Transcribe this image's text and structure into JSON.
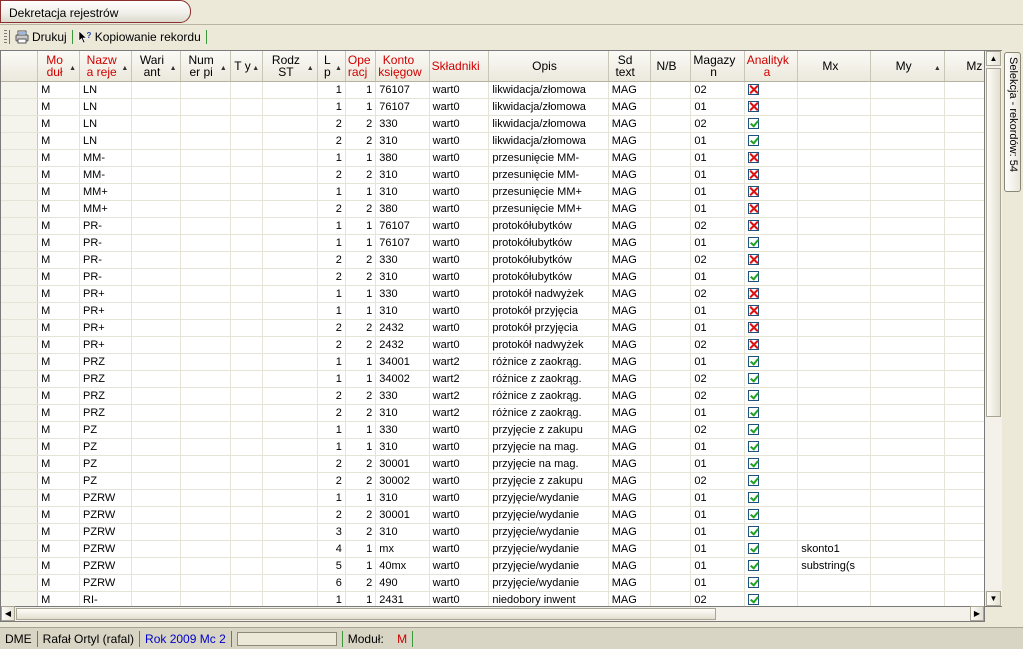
{
  "window": {
    "title": "Dekretacja rejestrów"
  },
  "toolbar": {
    "print_label": "Drukuj",
    "copy_label": "Kopiowanie rekordu"
  },
  "side_tab": {
    "label": "Selekcja - rekordów: 54"
  },
  "grid": {
    "columns": [
      {
        "key": "modul",
        "label": "Mo duł",
        "red": true,
        "sort": true
      },
      {
        "key": "nazwa",
        "label": "Nazw a reje",
        "red": true,
        "sort": true
      },
      {
        "key": "wariant",
        "label": "Wari ant",
        "red": false,
        "sort": true
      },
      {
        "key": "numer",
        "label": "Num er pi",
        "red": false,
        "sort": true
      },
      {
        "key": "typ",
        "label": "T y",
        "red": false,
        "sort": true
      },
      {
        "key": "rodzst",
        "label": "Rodz ST",
        "red": false,
        "sort": true
      },
      {
        "key": "lp",
        "label": "L p",
        "red": false,
        "sort": true
      },
      {
        "key": "operacja",
        "label": "Ope racj",
        "red": true,
        "sort": false
      },
      {
        "key": "konto",
        "label": "Konto księgow",
        "red": true,
        "sort": false
      },
      {
        "key": "skladniki",
        "label": "Składniki",
        "red": true,
        "sort": false
      },
      {
        "key": "opis",
        "label": "Opis",
        "red": false,
        "sort": false
      },
      {
        "key": "sdtext",
        "label": "Sd text",
        "red": false,
        "sort": false
      },
      {
        "key": "nb",
        "label": "N/B",
        "red": false,
        "sort": false
      },
      {
        "key": "magazyn",
        "label": "Magazy n",
        "red": false,
        "sort": false
      },
      {
        "key": "analityka",
        "label": "Analityk a",
        "red": true,
        "sort": false
      },
      {
        "key": "mx",
        "label": "Mx",
        "red": false,
        "sort": false
      },
      {
        "key": "my",
        "label": "My",
        "red": false,
        "sort": true
      },
      {
        "key": "mz",
        "label": "Mz",
        "red": false,
        "sort": false
      }
    ],
    "rows": [
      {
        "modul": "M",
        "nazwa": "LN",
        "lp": "1",
        "operacja": "1",
        "konto": "76107",
        "skladniki": "wart0",
        "opis": "likwidacja/złomowa",
        "sdtext": "MAG",
        "magazyn": "02",
        "analityka": false,
        "mx": ""
      },
      {
        "modul": "M",
        "nazwa": "LN",
        "lp": "1",
        "operacja": "1",
        "konto": "76107",
        "skladniki": "wart0",
        "opis": "likwidacja/złomowa",
        "sdtext": "MAG",
        "magazyn": "01",
        "analityka": false,
        "mx": ""
      },
      {
        "modul": "M",
        "nazwa": "LN",
        "lp": "2",
        "operacja": "2",
        "konto": "330",
        "skladniki": "wart0",
        "opis": "likwidacja/złomowa",
        "sdtext": "MAG",
        "magazyn": "02",
        "analityka": true,
        "mx": ""
      },
      {
        "modul": "M",
        "nazwa": "LN",
        "lp": "2",
        "operacja": "2",
        "konto": "310",
        "skladniki": "wart0",
        "opis": "likwidacja/złomowa",
        "sdtext": "MAG",
        "magazyn": "01",
        "analityka": true,
        "mx": ""
      },
      {
        "modul": "M",
        "nazwa": "MM-",
        "lp": "1",
        "operacja": "1",
        "konto": "380",
        "skladniki": "wart0",
        "opis": "przesunięcie MM-",
        "sdtext": "MAG",
        "magazyn": "01",
        "analityka": false,
        "mx": ""
      },
      {
        "modul": "M",
        "nazwa": "MM-",
        "lp": "2",
        "operacja": "2",
        "konto": "310",
        "skladniki": "wart0",
        "opis": "przesunięcie MM-",
        "sdtext": "MAG",
        "magazyn": "01",
        "analityka": false,
        "mx": ""
      },
      {
        "modul": "M",
        "nazwa": "MM+",
        "lp": "1",
        "operacja": "1",
        "konto": "310",
        "skladniki": "wart0",
        "opis": "przesunięcie MM+",
        "sdtext": "MAG",
        "magazyn": "01",
        "analityka": false,
        "mx": ""
      },
      {
        "modul": "M",
        "nazwa": "MM+",
        "lp": "2",
        "operacja": "2",
        "konto": "380",
        "skladniki": "wart0",
        "opis": "przesunięcie MM+",
        "sdtext": "MAG",
        "magazyn": "01",
        "analityka": false,
        "mx": ""
      },
      {
        "modul": "M",
        "nazwa": "PR-",
        "lp": "1",
        "operacja": "1",
        "konto": "76107",
        "skladniki": "wart0",
        "opis": "protokółubytków",
        "sdtext": "MAG",
        "magazyn": "02",
        "analityka": false,
        "mx": ""
      },
      {
        "modul": "M",
        "nazwa": "PR-",
        "lp": "1",
        "operacja": "1",
        "konto": "76107",
        "skladniki": "wart0",
        "opis": "protokółubytków",
        "sdtext": "MAG",
        "magazyn": "01",
        "analityka": true,
        "mx": ""
      },
      {
        "modul": "M",
        "nazwa": "PR-",
        "lp": "2",
        "operacja": "2",
        "konto": "330",
        "skladniki": "wart0",
        "opis": "protokółubytków",
        "sdtext": "MAG",
        "magazyn": "02",
        "analityka": false,
        "mx": ""
      },
      {
        "modul": "M",
        "nazwa": "PR-",
        "lp": "2",
        "operacja": "2",
        "konto": "310",
        "skladniki": "wart0",
        "opis": "protokółubytków",
        "sdtext": "MAG",
        "magazyn": "01",
        "analityka": true,
        "mx": ""
      },
      {
        "modul": "M",
        "nazwa": "PR+",
        "lp": "1",
        "operacja": "1",
        "konto": "330",
        "skladniki": "wart0",
        "opis": "protokół nadwyżek",
        "sdtext": "MAG",
        "magazyn": "02",
        "analityka": false,
        "mx": ""
      },
      {
        "modul": "M",
        "nazwa": "PR+",
        "lp": "1",
        "operacja": "1",
        "konto": "310",
        "skladniki": "wart0",
        "opis": "protokół przyjęcia",
        "sdtext": "MAG",
        "magazyn": "01",
        "analityka": false,
        "mx": ""
      },
      {
        "modul": "M",
        "nazwa": "PR+",
        "lp": "2",
        "operacja": "2",
        "konto": "2432",
        "skladniki": "wart0",
        "opis": "protokół przyjęcia",
        "sdtext": "MAG",
        "magazyn": "01",
        "analityka": false,
        "mx": ""
      },
      {
        "modul": "M",
        "nazwa": "PR+",
        "lp": "2",
        "operacja": "2",
        "konto": "2432",
        "skladniki": "wart0",
        "opis": "protokół nadwyżek",
        "sdtext": "MAG",
        "magazyn": "02",
        "analityka": false,
        "mx": ""
      },
      {
        "modul": "M",
        "nazwa": "PRZ",
        "lp": "1",
        "operacja": "1",
        "konto": "34001",
        "skladniki": "wart2",
        "opis": "różnice z zaokrąg.",
        "sdtext": "MAG",
        "magazyn": "01",
        "analityka": true,
        "mx": ""
      },
      {
        "modul": "M",
        "nazwa": "PRZ",
        "lp": "1",
        "operacja": "1",
        "konto": "34002",
        "skladniki": "wart2",
        "opis": "różnice z zaokrąg.",
        "sdtext": "MAG",
        "magazyn": "02",
        "analityka": true,
        "mx": ""
      },
      {
        "modul": "M",
        "nazwa": "PRZ",
        "lp": "2",
        "operacja": "2",
        "konto": "330",
        "skladniki": "wart2",
        "opis": "różnice z zaokrąg.",
        "sdtext": "MAG",
        "magazyn": "02",
        "analityka": true,
        "mx": ""
      },
      {
        "modul": "M",
        "nazwa": "PRZ",
        "lp": "2",
        "operacja": "2",
        "konto": "310",
        "skladniki": "wart2",
        "opis": "różnice z zaokrąg.",
        "sdtext": "MAG",
        "magazyn": "01",
        "analityka": true,
        "mx": ""
      },
      {
        "modul": "M",
        "nazwa": "PZ",
        "lp": "1",
        "operacja": "1",
        "konto": "330",
        "skladniki": "wart0",
        "opis": "przyjęcie z zakupu",
        "sdtext": "MAG",
        "magazyn": "02",
        "analityka": true,
        "mx": ""
      },
      {
        "modul": "M",
        "nazwa": "PZ",
        "lp": "1",
        "operacja": "1",
        "konto": "310",
        "skladniki": "wart0",
        "opis": "przyjęcie na mag.",
        "sdtext": "MAG",
        "magazyn": "01",
        "analityka": true,
        "mx": ""
      },
      {
        "modul": "M",
        "nazwa": "PZ",
        "lp": "2",
        "operacja": "2",
        "konto": "30001",
        "skladniki": "wart0",
        "opis": "przyjęcie na mag.",
        "sdtext": "MAG",
        "magazyn": "01",
        "analityka": true,
        "mx": ""
      },
      {
        "modul": "M",
        "nazwa": "PZ",
        "lp": "2",
        "operacja": "2",
        "konto": "30002",
        "skladniki": "wart0",
        "opis": "przyjęcie z zakupu",
        "sdtext": "MAG",
        "magazyn": "02",
        "analityka": true,
        "mx": ""
      },
      {
        "modul": "M",
        "nazwa": "PZRW",
        "lp": "1",
        "operacja": "1",
        "konto": "310",
        "skladniki": "wart0",
        "opis": "przyjęcie/wydanie",
        "sdtext": "MAG",
        "magazyn": "01",
        "analityka": true,
        "mx": ""
      },
      {
        "modul": "M",
        "nazwa": "PZRW",
        "lp": "2",
        "operacja": "2",
        "konto": "30001",
        "skladniki": "wart0",
        "opis": "przyjęcie/wydanie",
        "sdtext": "MAG",
        "magazyn": "01",
        "analityka": true,
        "mx": ""
      },
      {
        "modul": "M",
        "nazwa": "PZRW",
        "lp": "3",
        "operacja": "2",
        "konto": "310",
        "skladniki": "wart0",
        "opis": "przyjęcie/wydanie",
        "sdtext": "MAG",
        "magazyn": "01",
        "analityka": true,
        "mx": ""
      },
      {
        "modul": "M",
        "nazwa": "PZRW",
        "lp": "4",
        "operacja": "1",
        "konto": "mx",
        "skladniki": "wart0",
        "opis": "przyjęcie/wydanie",
        "sdtext": "MAG",
        "magazyn": "01",
        "analityka": true,
        "mx": "skonto1"
      },
      {
        "modul": "M",
        "nazwa": "PZRW",
        "lp": "5",
        "operacja": "1",
        "konto": "40mx",
        "skladniki": "wart0",
        "opis": "przyjęcie/wydanie",
        "sdtext": "MAG",
        "magazyn": "01",
        "analityka": true,
        "mx": "substring(s"
      },
      {
        "modul": "M",
        "nazwa": "PZRW",
        "lp": "6",
        "operacja": "2",
        "konto": "490",
        "skladniki": "wart0",
        "opis": "przyjęcie/wydanie",
        "sdtext": "MAG",
        "magazyn": "01",
        "analityka": true,
        "mx": ""
      },
      {
        "modul": "M",
        "nazwa": "RI-",
        "lp": "1",
        "operacja": "1",
        "konto": "2431",
        "skladniki": "wart0",
        "opis": "niedobory inwent",
        "sdtext": "MAG",
        "magazyn": "02",
        "analityka": true,
        "mx": ""
      }
    ]
  },
  "status": {
    "app": "DME",
    "user": "Rafał Ortyl (rafal)",
    "year_label": "Rok 2009",
    "month_label": "Mc 2",
    "module_label": "Moduł:",
    "module_value": "M"
  },
  "colors": {
    "header_red": "#d00000",
    "status_blue": "#0000cc",
    "check_green": "#21a121",
    "cross_red": "#d11111"
  }
}
